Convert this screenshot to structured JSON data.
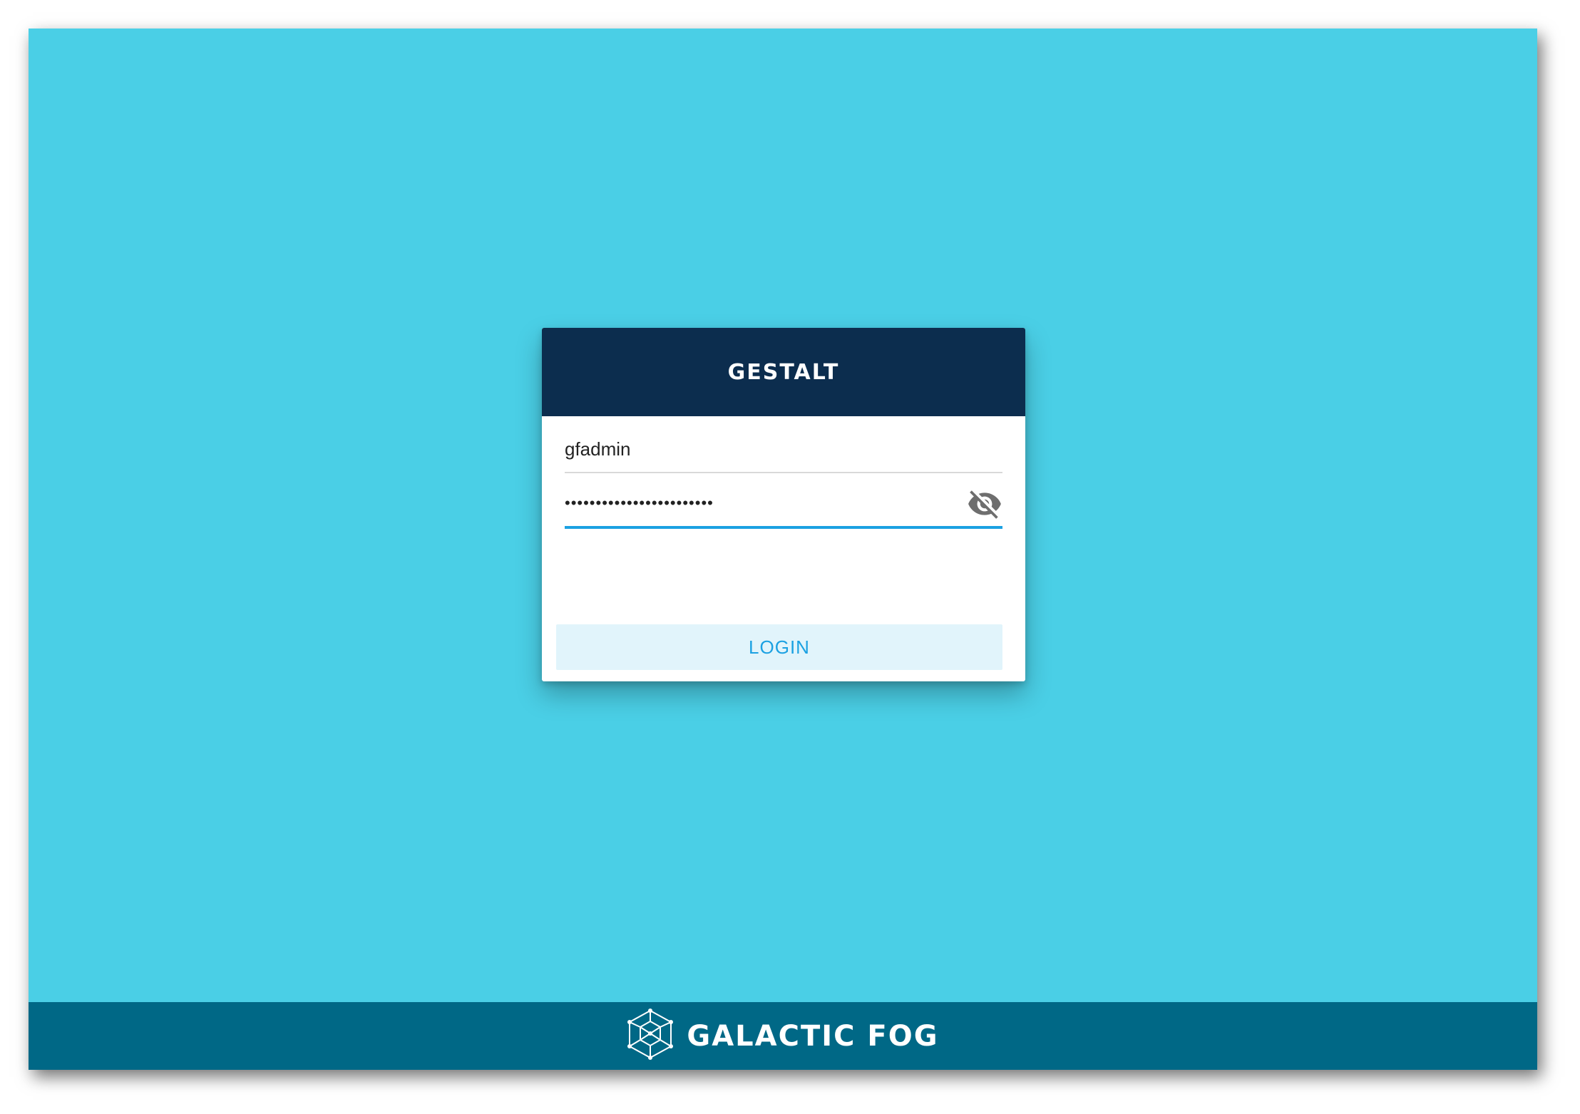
{
  "login": {
    "title": "GESTALT",
    "username": {
      "value": "gfadmin"
    },
    "password": {
      "value": "••••••••••••••••••••••••"
    },
    "visibility_icon": "eye-off-icon",
    "login_label": "LOGIN"
  },
  "footer": {
    "logo_icon": "galactic-fog-logo-icon",
    "brand": "GALACTIC FOG"
  },
  "colors": {
    "background": "#4acfe6",
    "header": "#0c2d4e",
    "footer": "#006886",
    "accent": "#1ba1e2",
    "button_bg": "#e1f4fb"
  }
}
